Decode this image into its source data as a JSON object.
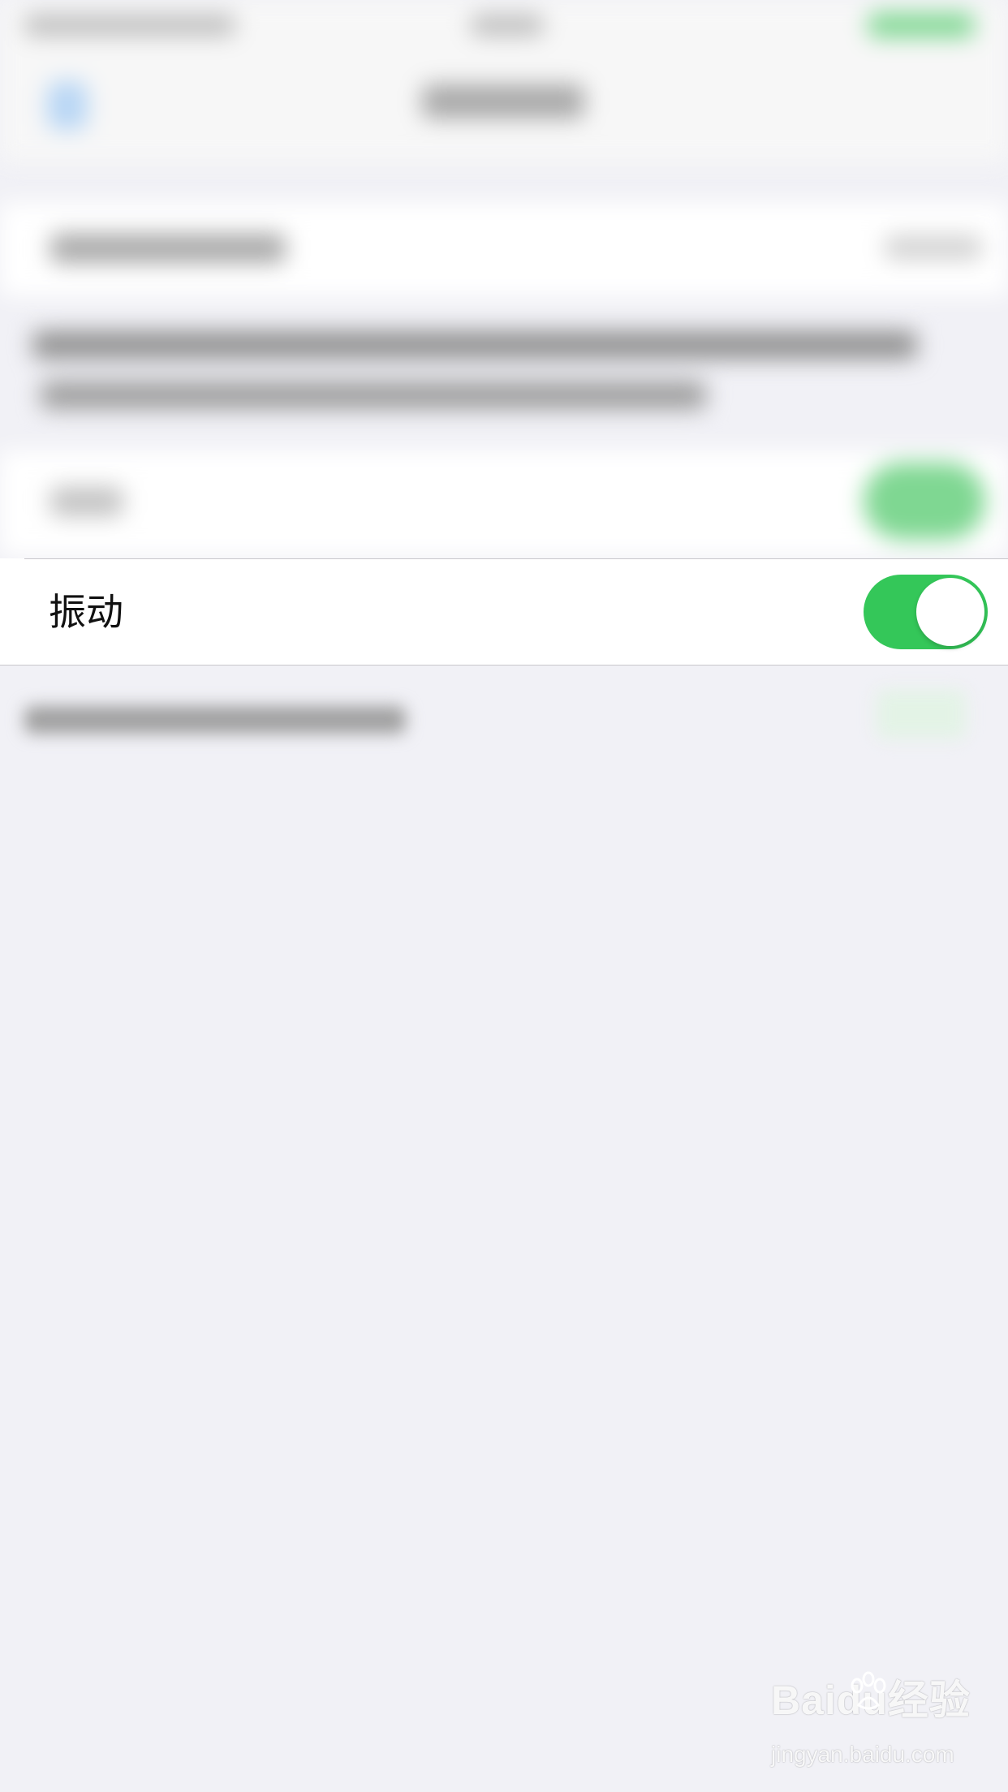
{
  "vibrate": {
    "label": "振动",
    "enabled": true
  },
  "watermark": {
    "logo": "Baidu经验",
    "url": "jingyan.baidu.com"
  },
  "colors": {
    "background": "#f1f1f6",
    "cell": "#ffffff",
    "toggle_on": "#34c759",
    "separator": "#c8c7cc"
  }
}
